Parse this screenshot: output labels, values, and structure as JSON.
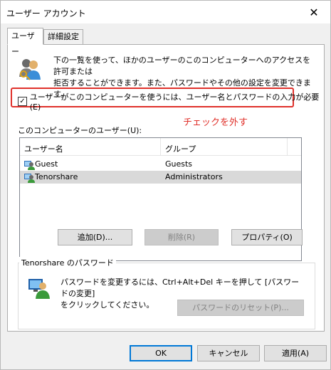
{
  "window": {
    "title": "ユーザー アカウント",
    "close_glyph": "✕"
  },
  "tabs": [
    {
      "label": "ユーザー",
      "active": true
    },
    {
      "label": "詳細設定",
      "active": false
    }
  ],
  "users_tab": {
    "description_line1": "下の一覧を使って、ほかのユーザーのこのコンピューターへのアクセスを許可または",
    "description_line2": "拒否することができます。また、パスワードやその他の設定を変更できます。",
    "require_login_checkbox": {
      "checked": true,
      "label": "ユーザーがこのコンピューターを使うには、ユーザー名とパスワードの入力が必要(E)"
    },
    "annotation": "チェックを外す",
    "annotation_color": "#e0312b",
    "users_list_label": "このコンピューターのユーザー(U):",
    "columns": [
      "ユーザー名",
      "グループ"
    ],
    "rows": [
      {
        "user": "Guest",
        "group": "Guests",
        "selected": false,
        "icon": "user-icon"
      },
      {
        "user": "Tenorshare",
        "group": "Administrators",
        "selected": true,
        "icon": "user-icon"
      }
    ],
    "buttons": {
      "add": "追加(D)...",
      "remove": "削除(R)",
      "properties": "プロパティ(O)"
    },
    "password_group": {
      "title": "Tenorshare のパスワード",
      "text_line1": "パスワードを変更するには、Ctrl+Alt+Del キーを押して [パスワードの変更]",
      "text_line2": "をクリックしてください。",
      "reset_button": "パスワードのリセット(P)..."
    }
  },
  "footer": {
    "ok": "OK",
    "cancel": "キャンセル",
    "apply": "適用(A)"
  }
}
